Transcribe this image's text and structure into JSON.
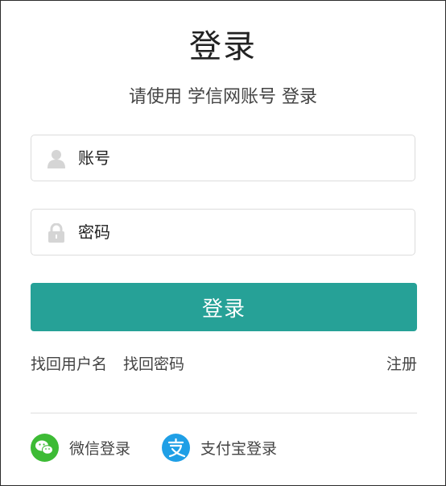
{
  "page": {
    "title": "登录",
    "subtitle": "请使用 学信网账号 登录"
  },
  "form": {
    "username_placeholder": "账号",
    "username_value": "",
    "password_placeholder": "密码",
    "password_value": "",
    "login_button": "登录"
  },
  "links": {
    "find_username": "找回用户名",
    "find_password": "找回密码",
    "register": "注册"
  },
  "social": {
    "wechat_label": "微信登录",
    "alipay_label": "支付宝登录"
  },
  "colors": {
    "primary": "#26a197",
    "wechat": "#3dbb35",
    "alipay": "#1f9fe6"
  },
  "icons": {
    "username": "user-icon",
    "password": "lock-icon",
    "wechat": "wechat-icon",
    "alipay": "alipay-icon"
  }
}
